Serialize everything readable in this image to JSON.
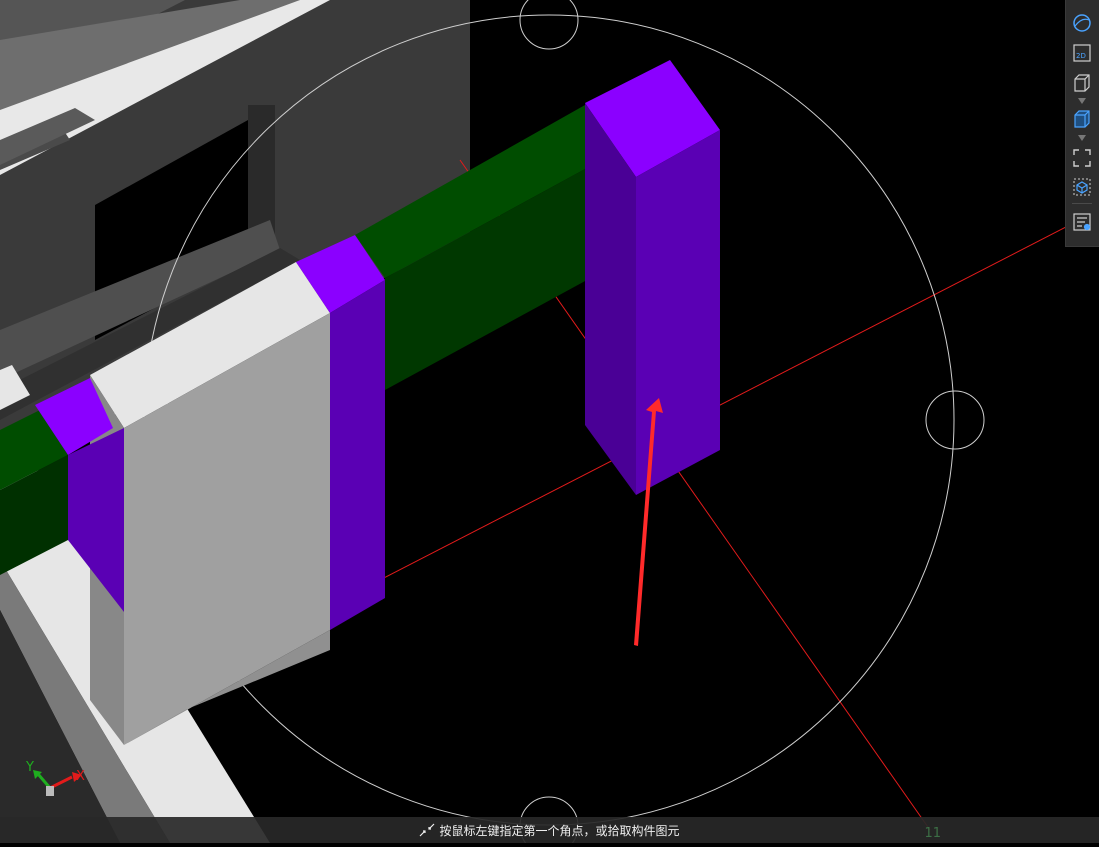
{
  "viewport": {
    "background": "#000000",
    "colors": {
      "column": "#5a00b4",
      "column_top": "#8b00ff",
      "beam": "#004d00",
      "wall": "#a0a0a0",
      "slab": "#e6e6e6",
      "dark_structure": "#3c3c3c",
      "axis_line": "#e21b1b",
      "navigation_circle": "#cfcfcf",
      "annotation_arrow": "#ff2a2a"
    }
  },
  "toolbar": {
    "buttons": [
      {
        "name": "orbit-view-icon"
      },
      {
        "name": "2d-view-icon",
        "text": "2D"
      },
      {
        "name": "3d-box-view-icon"
      },
      {
        "name": "3d-shaded-view-icon"
      },
      {
        "name": "zoom-extents-icon"
      },
      {
        "name": "local-3d-icon"
      },
      {
        "name": "properties-list-icon"
      }
    ]
  },
  "axis_triad": {
    "x_label": "X",
    "y_label": "Y"
  },
  "status": {
    "prompt": "按鼠标左键指定第一个角点，或拾取构件图元",
    "right_value": "11"
  }
}
